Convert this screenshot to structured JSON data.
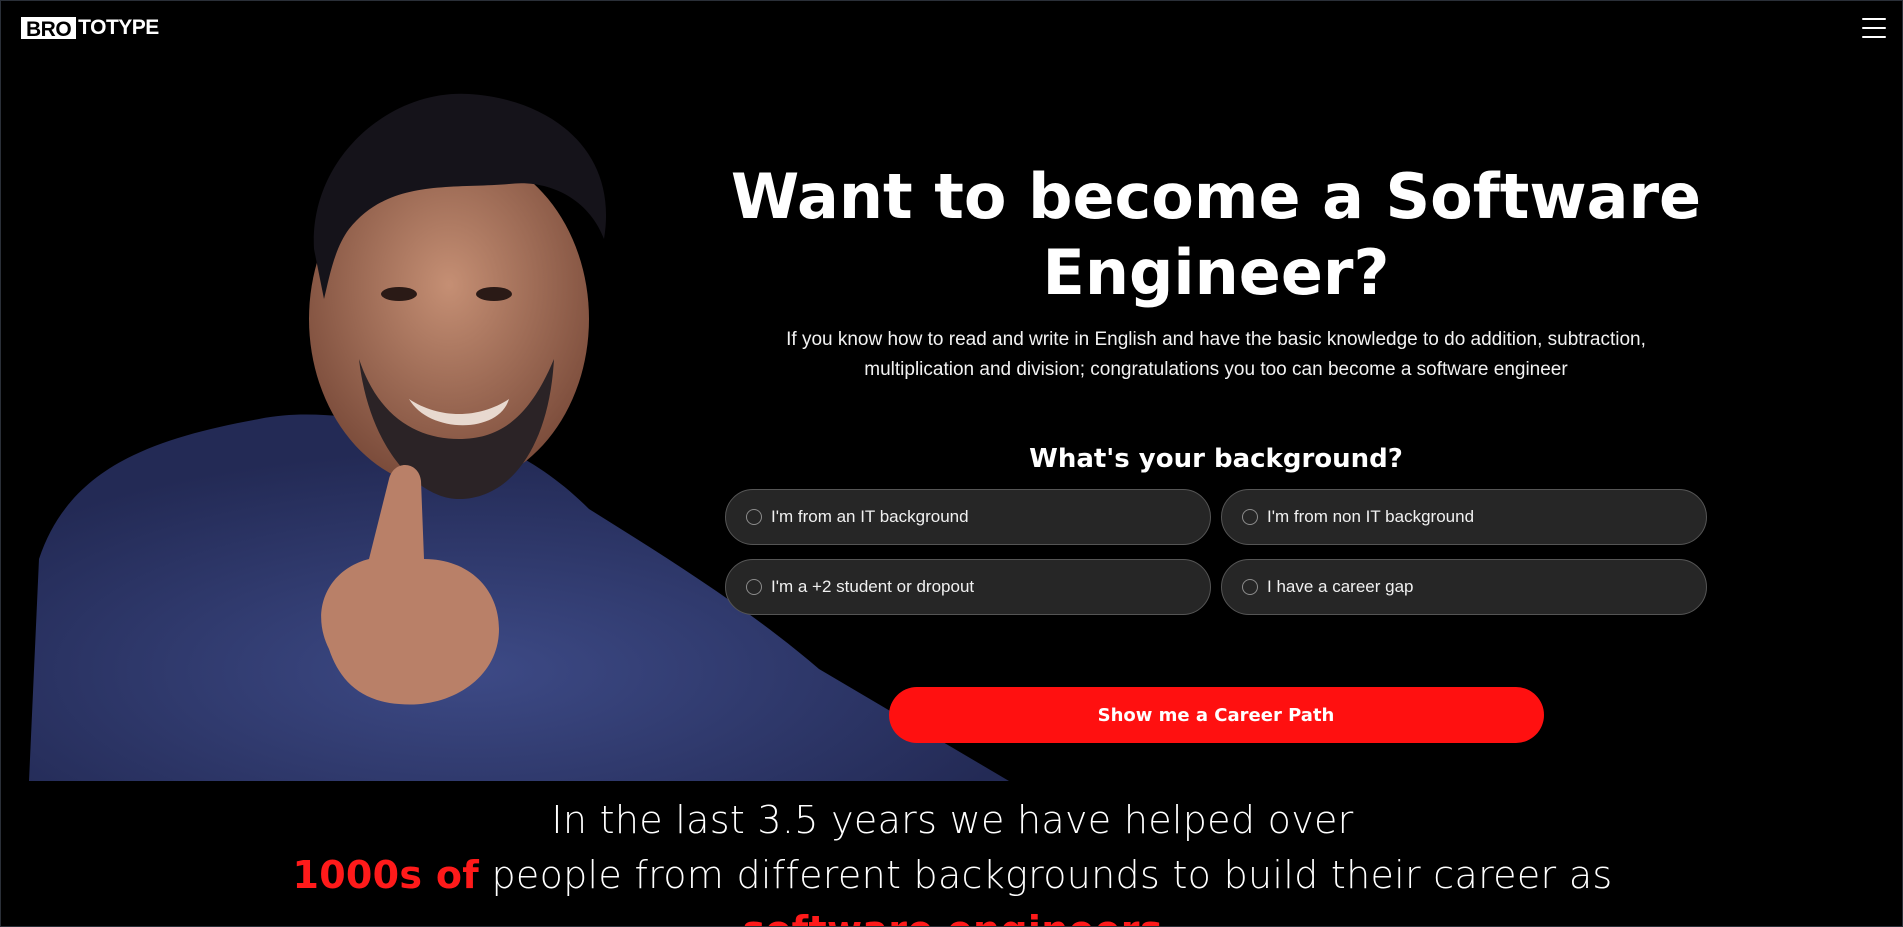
{
  "header": {
    "logo_bold": "BRO",
    "logo_rest": "TOTYPE"
  },
  "hero": {
    "headline": "Want to become a Software Engineer?",
    "subtext": "If you know how to read and write in English and have the basic knowledge to do addition, subtraction, multiplication and division; congratulations you too can become a software engineer",
    "question": "What's your background?",
    "options": [
      {
        "label": "I'm from an IT background"
      },
      {
        "label": "I'm from non IT background"
      },
      {
        "label": "I'm a +2 student or dropout"
      },
      {
        "label": "I have a career gap"
      }
    ],
    "cta_label": "Show me a Career Path"
  },
  "stats": {
    "line1": "In the last 3.5 years we have helped over",
    "highlight": "1000s of",
    "line2_rest": " people from different backgrounds to build their career as",
    "line3_partial": "software engineers"
  },
  "colors": {
    "accent": "#ff1010",
    "background": "#000000",
    "option_bg": "#262626"
  }
}
